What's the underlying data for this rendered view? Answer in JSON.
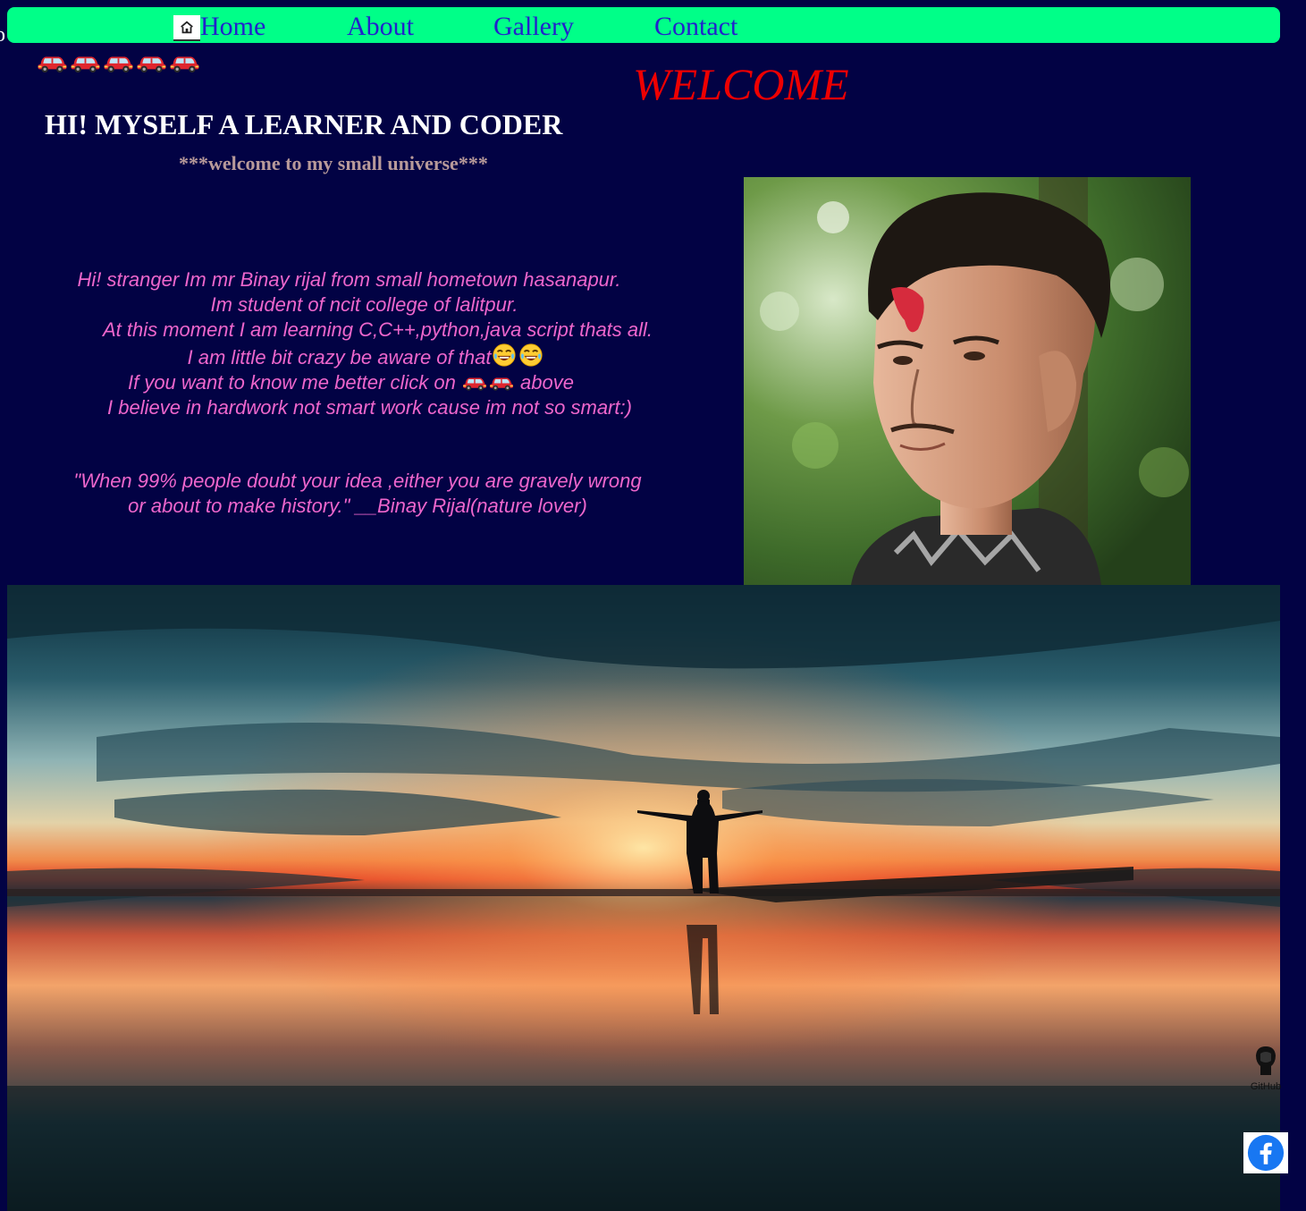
{
  "edge_char": "o",
  "nav": {
    "icon": "home-icon",
    "items": [
      {
        "label": "Home"
      },
      {
        "label": "About"
      },
      {
        "label": "Gallery"
      },
      {
        "label": "Contact"
      }
    ]
  },
  "header": {
    "car_icons": [
      "car-icon",
      "car-icon",
      "car-icon",
      "car-icon",
      "car-icon"
    ],
    "welcome": "WELCOME",
    "intro": "HI! MYSELF A LEARNER AND CODER",
    "subheading": "***welcome to my small universe***"
  },
  "bio": {
    "line1": "Hi! stranger Im mr Binay rijal from small hometown hasanapur.",
    "line2": "Im student of ncit college of lalitpur.",
    "line3": "At this moment I am learning C,C++,python,java script thats all.",
    "line4": "I am little bit crazy be aware of that",
    "line5_before": "If you want to know me better click on ",
    "line5_after": " above",
    "line6": "I believe in hardwork not smart work cause im not so smart:)"
  },
  "quote": {
    "line1": "\"When 99% people doubt your idea ,either you are gravely wrong",
    "line2": "or about to make history.\" __Binay Rijal(nature lover)"
  },
  "social": {
    "github_icon": "github-icon",
    "github_label": "GitHub",
    "facebook_icon": "facebook-icon"
  },
  "colors": {
    "background": "#020244",
    "navbar": "#00ff88",
    "nav_link": "#2222cc",
    "welcome": "#ee0000",
    "bio_text": "#ee66cc",
    "subheading": "#b89a9a"
  }
}
